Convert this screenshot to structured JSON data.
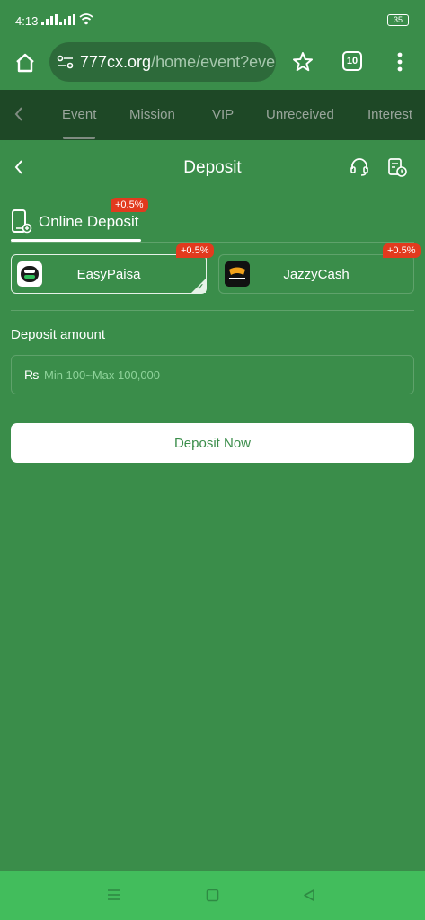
{
  "status_bar": {
    "time": "4:13",
    "battery": "35"
  },
  "browser": {
    "url_host": "777cx.org",
    "url_path": "/home/event?eve",
    "tab_count": "10"
  },
  "page_nav": {
    "items": [
      "Event",
      "Mission",
      "VIP",
      "Unreceived",
      "Interest"
    ],
    "active": "Event"
  },
  "deposit": {
    "title": "Deposit",
    "method_tab": {
      "label": "Online Deposit",
      "bonus": "+0.5%"
    },
    "channels": [
      {
        "name": "EasyPaisa",
        "bonus": "+0.5%",
        "selected": true
      },
      {
        "name": "JazzyCash",
        "bonus": "+0.5%",
        "selected": false
      }
    ],
    "amount_label": "Deposit amount",
    "currency_symbol": "₨",
    "amount_placeholder": "Min 100~Max 100,000",
    "amount_value": "",
    "submit_label": "Deposit Now"
  },
  "colors": {
    "page_green": "#3a8d4a",
    "nav_dark": "#1e4826",
    "system_nav": "#42bd5c",
    "badge_red": "#e23a1e",
    "placeholder_green": "#8ed39a"
  },
  "icons": {
    "home": "home-icon",
    "site_settings": "site-settings-icon",
    "bookmark": "star-icon",
    "menu": "more-vert-icon",
    "support": "headset-icon",
    "history": "history-icon",
    "method": "phone-deposit-icon"
  }
}
